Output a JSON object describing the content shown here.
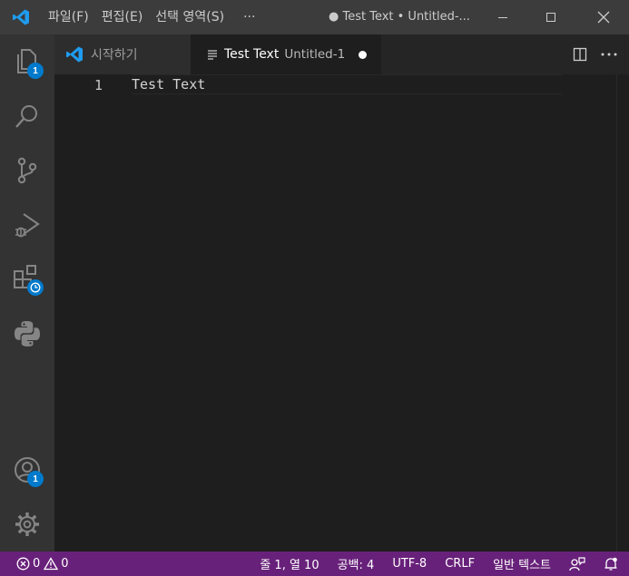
{
  "titlebar": {
    "menu": [
      "파일(F)",
      "편집(E)",
      "선택 영역(S)",
      "···"
    ],
    "title": "● Test Text • Untitled-..."
  },
  "activity_bar": {
    "explorer_badge": "1",
    "account_badge": "1"
  },
  "tabs": {
    "start_label": "시작하기",
    "active_label": "Test Text",
    "active_sublabel": "Untitled-1"
  },
  "editor": {
    "line_number": "1",
    "line_text": "Test Text"
  },
  "statusbar": {
    "errors": "0",
    "warnings": "0",
    "cursor": "줄 1, 열 10",
    "indent": "공백: 4",
    "encoding": "UTF-8",
    "eol": "CRLF",
    "language": "일반 텍스트"
  },
  "colors": {
    "accent": "#007acc",
    "statusbar": "#68217a",
    "titlebar": "#3c3c3c",
    "activitybar": "#333333",
    "editor_bg": "#1e1e1e"
  }
}
